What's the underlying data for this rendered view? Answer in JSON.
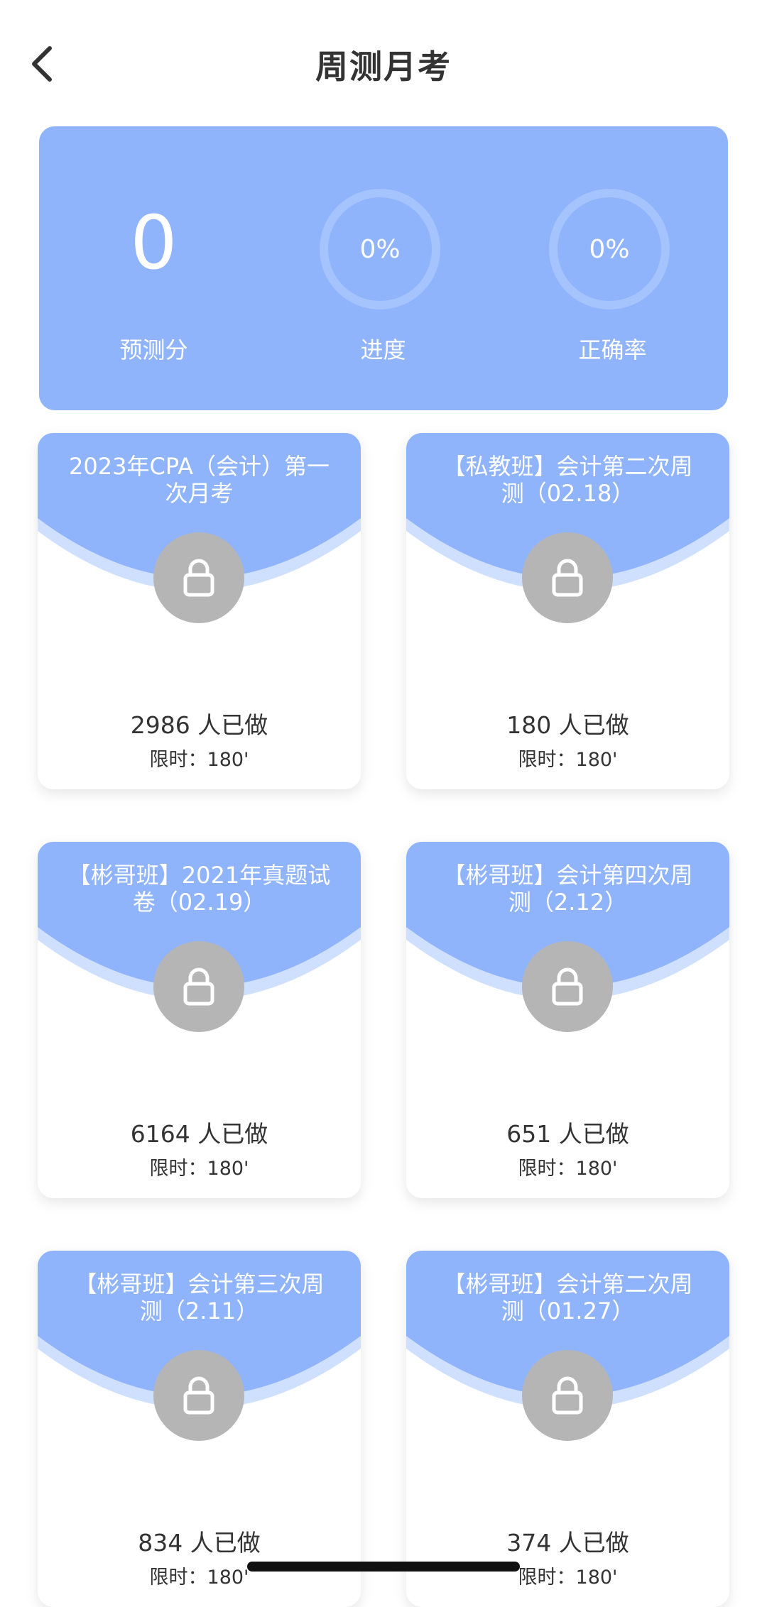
{
  "header": {
    "title": "周测月考"
  },
  "stats": {
    "score": {
      "value": "0",
      "label": "预测分"
    },
    "progress": {
      "value": "0%",
      "label": "进度",
      "fraction": 0
    },
    "accuracy": {
      "value": "0%",
      "label": "正确率",
      "fraction": 0
    }
  },
  "exams": [
    {
      "title": "2023年CPA（会计）第一次月考",
      "done": "2986 人已做",
      "limit": "限时：180'"
    },
    {
      "title": "【私教班】会计第二次周测（02.18）",
      "done": "180 人已做",
      "limit": "限时：180'"
    },
    {
      "title": "【彬哥班】2021年真题试卷（02.19）",
      "done": "6164 人已做",
      "limit": "限时：180'"
    },
    {
      "title": "【彬哥班】会计第四次周测（2.12）",
      "done": "651 人已做",
      "limit": "限时：180'"
    },
    {
      "title": "【彬哥班】会计第三次周测（2.11）",
      "done": "834 人已做",
      "limit": "限时：180'"
    },
    {
      "title": "【彬哥班】会计第二次周测（01.27）",
      "done": "374 人已做",
      "limit": "限时：180'"
    }
  ],
  "colors": {
    "accent": "#8fb4fb",
    "lock": "#b5b5b5"
  }
}
